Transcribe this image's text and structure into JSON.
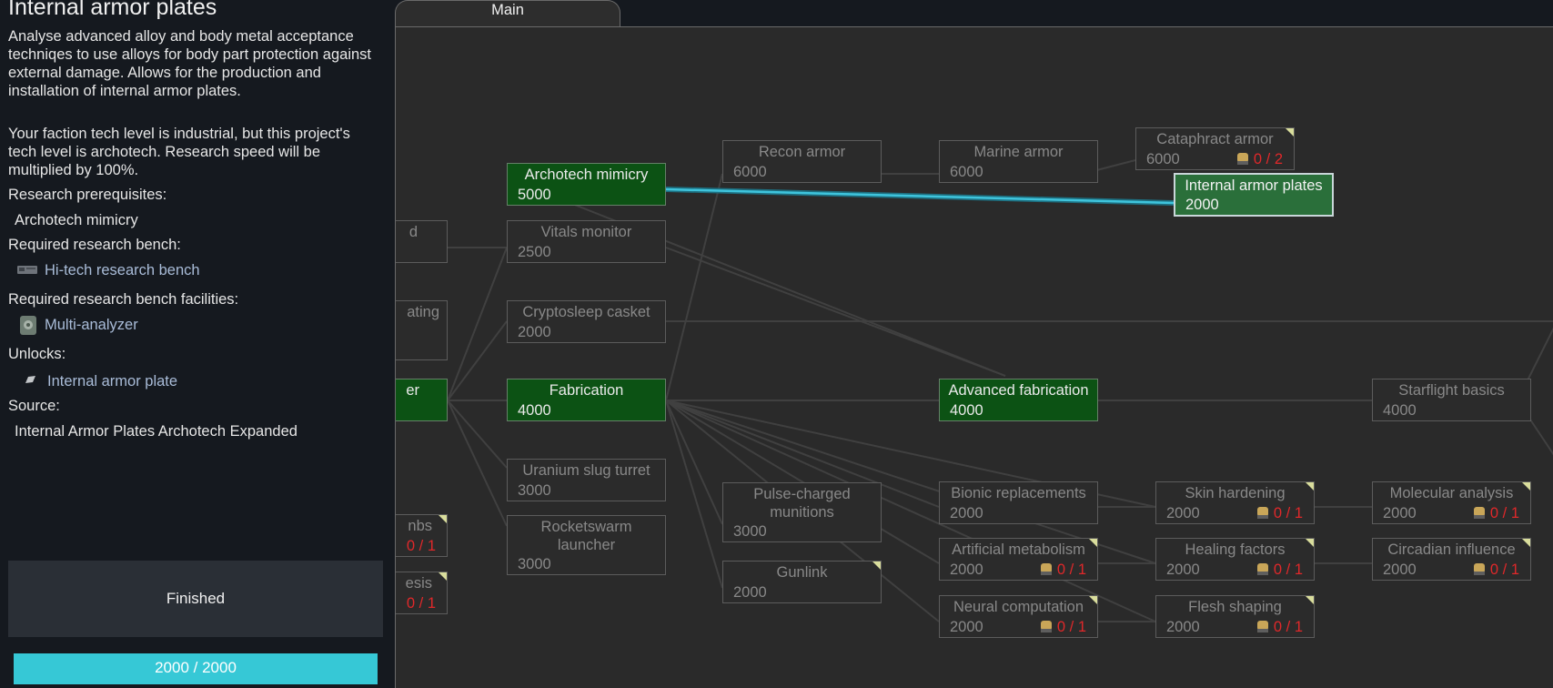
{
  "detail": {
    "title": "Internal armor plates",
    "description": "Analyse advanced alloy and body metal acceptance techniqes to use alloys for body part protection against external damage. Allows for the production and installation of internal armor plates.",
    "tech_level_note": "Your faction tech level is industrial, but this project's tech level is archotech. Research speed will be multiplied by 100%.",
    "prereq_label": "Research prerequisites:",
    "prereq_value": "Archotech mimicry",
    "bench_label": "Required research bench:",
    "bench_value": "Hi-tech research bench",
    "facilities_label": "Required research bench facilities:",
    "facilities_value": "Multi-analyzer",
    "unlocks_label": "Unlocks:",
    "unlocks_value": "Internal armor plate",
    "source_label": "Source:",
    "source_value": "Internal Armor Plates Archotech Expanded",
    "status": "Finished",
    "progress_text": "2000 / 2000",
    "progress_fraction": 1.0,
    "colors": {
      "progress": "#36c8d6",
      "link": "#a9bcd8",
      "finished_node": "#0c5214",
      "selected_node": "#2a6f3a",
      "path_line": "#3fc4dc"
    }
  },
  "tabs": {
    "main": "Main"
  },
  "nodes": {
    "cut1": {
      "label": "d",
      "cost": ""
    },
    "cut2": {
      "label": "ating",
      "cost": ""
    },
    "cut3": {
      "label": "er",
      "cost": ""
    },
    "cut4": {
      "label": "nbs",
      "cost": "",
      "req": "0 / 1"
    },
    "cut5": {
      "label": "esis",
      "cost": "",
      "req": "0 / 1"
    },
    "archotech_mimicry": {
      "label": "Archotech mimicry",
      "cost": "5000"
    },
    "vitals_monitor": {
      "label": "Vitals monitor",
      "cost": "2500"
    },
    "cryptosleep_casket": {
      "label": "Cryptosleep casket",
      "cost": "2000"
    },
    "fabrication": {
      "label": "Fabrication",
      "cost": "4000"
    },
    "uranium_slug_turret": {
      "label": "Uranium slug turret",
      "cost": "3000"
    },
    "rocketswarm_launcher": {
      "label": "Rocketswarm launcher",
      "cost": "3000"
    },
    "recon_armor": {
      "label": "Recon armor",
      "cost": "6000"
    },
    "pulse_charged_munitions": {
      "label": "Pulse-charged munitions",
      "cost": "3000"
    },
    "gunlink": {
      "label": "Gunlink",
      "cost": "2000"
    },
    "marine_armor": {
      "label": "Marine armor",
      "cost": "6000"
    },
    "advanced_fabrication": {
      "label": "Advanced fabrication",
      "cost": "4000"
    },
    "bionic_replacements": {
      "label": "Bionic replacements",
      "cost": "2000"
    },
    "artificial_metabolism": {
      "label": "Artificial metabolism",
      "cost": "2000",
      "req": "0 / 1"
    },
    "neural_computation": {
      "label": "Neural computation",
      "cost": "2000",
      "req": "0 / 1"
    },
    "cataphract_armor": {
      "label": "Cataphract armor",
      "cost": "6000",
      "req": "0 / 2"
    },
    "internal_armor_plates": {
      "label": "Internal armor plates",
      "cost": "2000"
    },
    "skin_hardening": {
      "label": "Skin hardening",
      "cost": "2000",
      "req": "0 / 1"
    },
    "healing_factors": {
      "label": "Healing factors",
      "cost": "2000",
      "req": "0 / 1"
    },
    "flesh_shaping": {
      "label": "Flesh shaping",
      "cost": "2000",
      "req": "0 / 1"
    },
    "starflight_basics": {
      "label": "Starflight basics",
      "cost": "4000"
    },
    "molecular_analysis": {
      "label": "Molecular analysis",
      "cost": "2000",
      "req": "0 / 1"
    },
    "circadian_influence": {
      "label": "Circadian influence",
      "cost": "2000",
      "req": "0 / 1"
    }
  }
}
